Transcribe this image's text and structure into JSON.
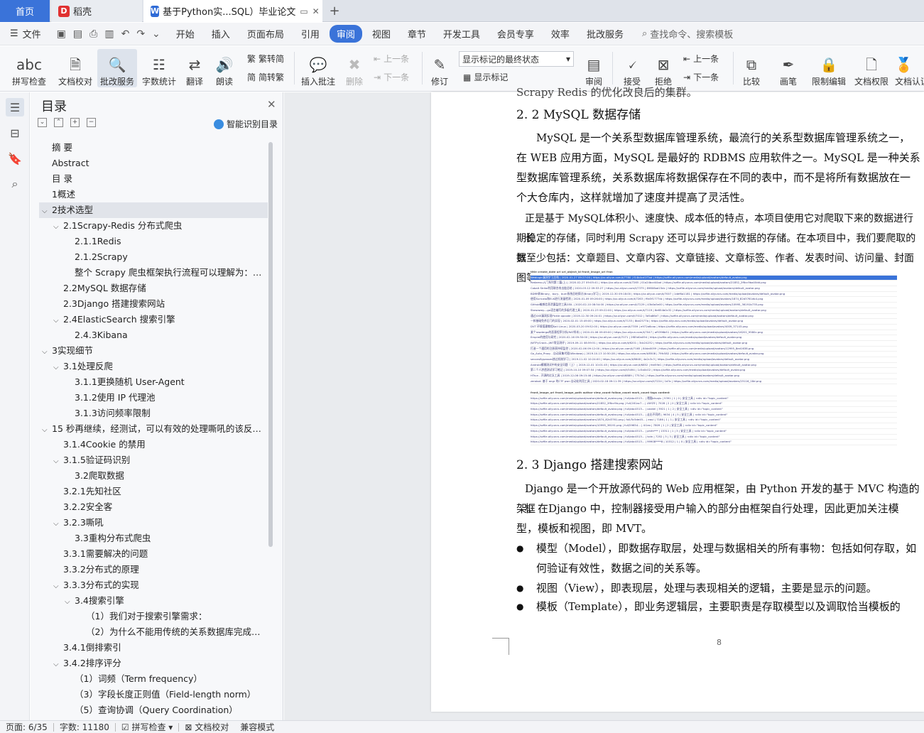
{
  "tabs": {
    "home": "首页",
    "daoke": "稻壳",
    "doc": "基于Python实...SQL）毕业论文",
    "new_tab": "+"
  },
  "menubar": {
    "file": "文件",
    "items": [
      "开始",
      "插入",
      "页面布局",
      "引用",
      "审阅",
      "视图",
      "章节",
      "开发工具",
      "会员专享",
      "效率",
      "批改服务"
    ],
    "active": "审阅",
    "search": "查找命令、搜索模板"
  },
  "ribbon": {
    "spellcheck": "拼写检查",
    "proofread": "文档校对",
    "correction": "批改服务",
    "wordcount": "字数统计",
    "translate": "翻译",
    "read": "朗读",
    "trad2simp": "繁转简",
    "simp2trad": "简转繁",
    "insert_comment": "插入批注",
    "delete": "删除",
    "prev_comment": "上一条",
    "next_comment": "下一条",
    "revise": "修订",
    "markup_select": "显示标记的最终状态",
    "show_markup": "显示标记",
    "review": "审阅",
    "accept": "接受",
    "reject": "拒绝",
    "prev_change": "上一条",
    "next_change": "下一条",
    "compare": "比较",
    "ink": "画笔",
    "restrict_edit": "限制编辑",
    "doc_permission": "文档权限",
    "doc_cert": "文档认证"
  },
  "toc": {
    "title": "目录",
    "smart": "智能识别目录",
    "items": [
      {
        "label": "摘  要",
        "level": 0,
        "caret": ""
      },
      {
        "label": "Abstract",
        "level": 0,
        "caret": ""
      },
      {
        "label": "目  录",
        "level": 0,
        "caret": ""
      },
      {
        "label": "1概述",
        "level": 0,
        "caret": ""
      },
      {
        "label": "2技术选型",
        "level": 0,
        "caret": "v",
        "selected": true
      },
      {
        "label": "2.1Scrapy-Redis 分布式爬虫",
        "level": 1,
        "caret": "v"
      },
      {
        "label": "2.1.1Redis",
        "level": 2,
        "caret": ""
      },
      {
        "label": "2.1.2Scrapy",
        "level": 2,
        "caret": ""
      },
      {
        "label": "整个 Scrapy 爬虫框架执行流程可以理解为：爬虫...",
        "level": 2,
        "caret": ""
      },
      {
        "label": "2.2MySQL 数据存储",
        "level": 1,
        "caret": ""
      },
      {
        "label": "2.3Django 搭建搜索网站",
        "level": 1,
        "caret": ""
      },
      {
        "label": "2.4ElasticSearch 搜索引擎",
        "level": 1,
        "caret": "v"
      },
      {
        "label": "2.4.3Kibana",
        "level": 2,
        "caret": ""
      },
      {
        "label": "3实现细节",
        "level": 0,
        "caret": "v"
      },
      {
        "label": "3.1处理反爬",
        "level": 1,
        "caret": "v"
      },
      {
        "label": "3.1.1更换随机 User-Agent",
        "level": 2,
        "caret": ""
      },
      {
        "label": "3.1.2使用 IP 代理池",
        "level": 2,
        "caret": ""
      },
      {
        "label": "3.1.3访问频率限制",
        "level": 2,
        "caret": ""
      },
      {
        "label": "15 秒再继续，经测试，可以有效的处理嘶吼的该反爬机制",
        "level": 0,
        "caret": "v"
      },
      {
        "label": "3.1.4Cookie 的禁用",
        "level": 1,
        "caret": ""
      },
      {
        "label": "3.1.5验证码识别",
        "level": 1,
        "caret": "v"
      },
      {
        "label": "3.2爬取数据",
        "level": 2,
        "caret": ""
      },
      {
        "label": "3.2.1先知社区",
        "level": 1,
        "caret": ""
      },
      {
        "label": "3.2.2安全客",
        "level": 1,
        "caret": ""
      },
      {
        "label": "3.2.3嘶吼",
        "level": 1,
        "caret": "v"
      },
      {
        "label": "3.3重构分布式爬虫",
        "level": 2,
        "caret": ""
      },
      {
        "label": "3.3.1需要解决的问题",
        "level": 1,
        "caret": ""
      },
      {
        "label": "3.3.2分布式的原理",
        "level": 1,
        "caret": ""
      },
      {
        "label": "3.3.3分布式的实现",
        "level": 1,
        "caret": "v"
      },
      {
        "label": "3.4搜索引擎",
        "level": 2,
        "caret": "v"
      },
      {
        "label": "（1）我们对于搜索引擎需求：",
        "level": 3,
        "caret": ""
      },
      {
        "label": "（2）为什么不能用传统的关系数据库完成搜索引擎...",
        "level": 3,
        "caret": ""
      },
      {
        "label": "3.4.1倒排索引",
        "level": 1,
        "caret": ""
      },
      {
        "label": "3.4.2排序评分",
        "level": 1,
        "caret": "v"
      },
      {
        "label": "（1）词频（Term frequency）",
        "level": 2,
        "caret": ""
      },
      {
        "label": "（3）字段长度正则值（Field-length norm）",
        "level": 2,
        "caret": ""
      },
      {
        "label": "（5）查询协调（Query Coordination）",
        "level": 2,
        "caret": ""
      }
    ]
  },
  "document": {
    "top_fragment": "Scrapy  Redis 的优化改良后的集群。",
    "h2_2": "2. 2  MySQL 数据存储",
    "p_mysql_lines": [
      "MySQL 是一个关系型数据库管理系统，最流行的关系型数据库管理系统之一，",
      "在 WEB 应用方面，MySQL 是最好的 RDBMS 应用软件之一。MySQL 是一种关系",
      "型数据库管理系统，关系数据库将数据保存在不同的表中，而不是将所有数据放在一",
      "个大仓库内，这样就增加了速度并提高了灵活性。"
    ],
    "p_store_lines": [
      "正是基于 MySQL体积小、速度快、成本低的特点，本项目使用它对爬取下来的数据进行长",
      "期稳定的存储，同时利用 Scrapy 还可以异步进行数据的存储。在本项目中，我们要爬取的数",
      "据至少包括：文章题目、文章内容、文章链接、文章标签、作者、发表时间、访问量、封面图等。"
    ],
    "h2_3": "2. 3  Django 搭建搜索网站",
    "p_django_lines": [
      "Django 是一个开放源代码的 Web 应用框架，由 Python 开发的基于 MVC 构造的框",
      "架。在Django 中，控制器接受用户输入的部分由框架自行处理，因此更加关注模",
      "型，模板和视图，即 MVT。"
    ],
    "bullets": [
      {
        "lines": [
          "模型（Model），即数据存取层，处理与数据相关的所有事物：包括如何存取，如",
          "何验证有效性，数据之间的关系等。"
        ]
      },
      {
        "lines": [
          "视图（View），即表现层，处理与表现相关的逻辑，主要是显示的问题。"
        ]
      },
      {
        "lines": [
          "模板（Template），即业务逻辑层，主要职责是存取模型以及调取恰当模板的"
        ]
      }
    ],
    "page_number": "8",
    "table1_header": [
      "title",
      "create_date",
      "url",
      "url_object_id",
      "front_image_url",
      "fron"
    ],
    "table1_rows": [
      "Weblogic漏洞学习总结 | 2020-01-27 09:27:00 | https://xz.aliyun.com/t/7780 | f14b4cd1f7ad | https://xzfile.aliyuncs.com/media/upload/avatars/default_avatar.png",
      "Redamsu入门系列第二篇(上) | 2020-02-27 09:05:41 | https://xz.aliyun.com/t/7265 | 01a24bcd44ad | https://xzfile.aliyuncs.com/media/upload/avatars/21852_2f6cc9ba40dd.png",
      "Cobalt Strike利用联合攻击链总结 | 2020-03-12 09:53:27 | https://xz.aliyun.com/t/7375 | 89808ad15dc | https://xzfile.aliyuncs.com/media/upload/avatars/default_avatar.png",
      "BDRR和Binary、bury、bum系统总结探讨(Binary学习) | 2019-12-30 09:18:00 | https://xz.aliyun.com/t/7007 | 1def6a1181 | https://xzfile.aliyuncs.com/media/upload/avatars/default_avatar.png",
      "使用Suricata和ELK进行流量检测 | 2020-01-09 09:26:00 | https://xz.aliyun.com/t/7263 | f9e3f1777dc | https://xzfile.aliyuncs.com/media/upload/avatars/1874_82d3761eb4.png",
      "Github敏感信息泄露监控工具GSIL | 2020-02-10 08:54:00 | https://xz.aliyun.com/t/7229 | 43b0a5e00 | https://xzfile.aliyuncs.com/media/upload/avatars/10995_36191b735.png",
      "Stowaway---go语言编写的多级代理工具 | 2020-01-23 09:22:00 | https://xz.aliyun.com/t/7119 | 6e654b0c32 | https://xzfile.aliyuncs.com/media/upload/avatars/default_avatar.png",
      "通过XXE漏洞实现Pickle opcode | 2019-12-30 09:24:01 | https://xz.aliyun.com/t/7012 | 3e5a86e7 | https://xzfile.aliyuncs.com/media/upload/avatars/default_avatar.png",
      "一款基础免杀后门的实现 | 2020-02-01 15:49:00 | https://xz.aliyun.com/t/7133 | 8be2577b | https://xzfile.aliyuncs.com/media/upload/avatars/default_avatar.png",
      "DVT 环境搭建教程Kali Linux | 2020-03-20 09:52:00 | https://xz.aliyun.com/t/7359 | e972a6caa | https://xzfile.aliyuncs.com/media/upload/avatars/4009_37143.png",
      "某个rowdergo的恶意程序分析(RAT样本) | 2020-01-06 09:09:00 | https://xz.aliyun.com/t/7047 | af5396b51 | https://xzfile.aliyuncs.com/media/upload/avatars/16201_9580c.png",
      "Empire的使用与研究 | 2020-02-16 09:30:00 | https://xz.aliyun.com/t/7071 | 2f85d0a094 | https://xzfile.aliyuncs.com/media/upload/avatars/default_avatar.png",
      "JWTPyCrack--JWT常见测评 | 2019-09-11 08:59:51 | https://xz.aliyun.com/t/6201 | 3dc24232 | https://xzfile.aliyuncs.com/media/upload/avatars/default_avatar.png",
      "打造一个通用的注册表持续监控 | 2020-02-06 09:12:00 | https://xz.aliyun.com/t/7165 | 84da0059 | https://xzfile.aliyuncs.com/media/upload/avatars/12995_8ed1638.png",
      "Go_Auto_Proxy - 自动采集代理(Windows) | 2019-10-13 10:50:28 | https://xz.aliyun.com/t/6508 | 79fc582 | https://xzfile.aliyuncs.com/media/upload/avatars/default_avatar.png",
      "seconsBypasses绕过机制学习 | 2019-11-02 10:24:00 | https://xz.aliyun.com/t/6648 | 4a2c3c3 | https://xzfile.aliyuncs.com/media/upload/avatars/default_avatar.png",
      "Android模糊测试中的安全问题（上） | 2019-12-01 10:01:45 | https://xz.aliyun.com/t/6852 | fee59e1 | https://xzfile.aliyuncs.com/media/upload/avatars/default_avatar.png",
      "第二个人渗透测试学习笔记 | 2019-10-10 09:07:54 | https://xz.aliyun.com/t/5494 | 1c5a0c02 | https://xzfile.aliyuncs.com/media/upload/avatars/default_avatar.png",
      "HTrun - 开源的红队工具 | 2019-12-06 09:15:46 | https://xz.aliyun.com/t/6889 | 7757a1 | https://xzfile.aliyuncs.com/media/upload/avatars/default_avatar.png",
      "zerobot- 基于 angr 的CTF pwn 自动化利用工具 | 2020-02-18 09:11:39 | https://xz.aliyun.com/t/7224 | 1d3c | https://xzfile.aliyuncs.com/media/upload/avatars/23116_18d.png"
    ],
    "table2_header": [
      "front_image_url",
      "front_image_path",
      "author",
      "view_count",
      "follow_count",
      "mark_count",
      "tags",
      "content"
    ],
    "table2_rows": [
      "https://xzfile.aliyuncs.com/media/upload/avatars/default_avatar.png | full/abc4513... | 哦豁shuqiu | 5391 | 1 | 0 | 安全工具 | <div id=\"topic_content\"",
      "https://xzfile.aliyuncs.com/media/upload/avatars/21852_2f6cc9b.png | full/161ac7... | LNYZE | 7028 | 2 | 0 | 安全工具 | <div id=\"topic_content\"",
      "https://xzfile.aliyuncs.com/media/upload/avatars/default_avatar.png | full/abc4513... | castiel | 3921 | 1 | 2 | 安全工具 | <div id=\"topic_content\"",
      "https://xzfile.aliyuncs.com/media/upload/avatars/default_avatar.png | full/abc4513... | 走出不同的 | 9634 | 4 | 5 | 安全工具 | <div id=\"topic_content\"",
      "https://xzfile.aliyuncs.com/media/upload/avatars/1874_82d3761.png | full/5c5de45... | eaul | 7186 | 1 | 1 | 安全工具 | <div id=\"topic_content\"",
      "https://xzfile.aliyuncs.com/media/upload/avatars/10995_36191.png | full/59654... | 4i1ex | 7809 | 1 | 2 | 安全工具 | <div id=\"topic_content\"",
      "https://xzfile.aliyuncs.com/media/upload/avatars/default_avatar.png | full/abc4513... | phith*** | 15311 | 1 | 3 | 安全工具 | <div id=\"topic_content\"",
      "https://xzfile.aliyuncs.com/media/upload/avatars/default_avatar.png | full/abc4513... | lvdn | 7252 | 3 | 3 | 安全工具 | <div id=\"topic_content\"",
      "https://xzfile.aliyuncs.com/media/upload/avatars/default_avatar.png | full/abc4513... | 99908****8 | 10312 | 1 | 0 | 安全工具 | <div id=\"topic_content\""
    ]
  },
  "status": {
    "page": "页面: 6/35",
    "words": "字数: 11180",
    "spellcheck": "拼写检查",
    "proofread": "文档校对",
    "compat": "兼容模式"
  }
}
